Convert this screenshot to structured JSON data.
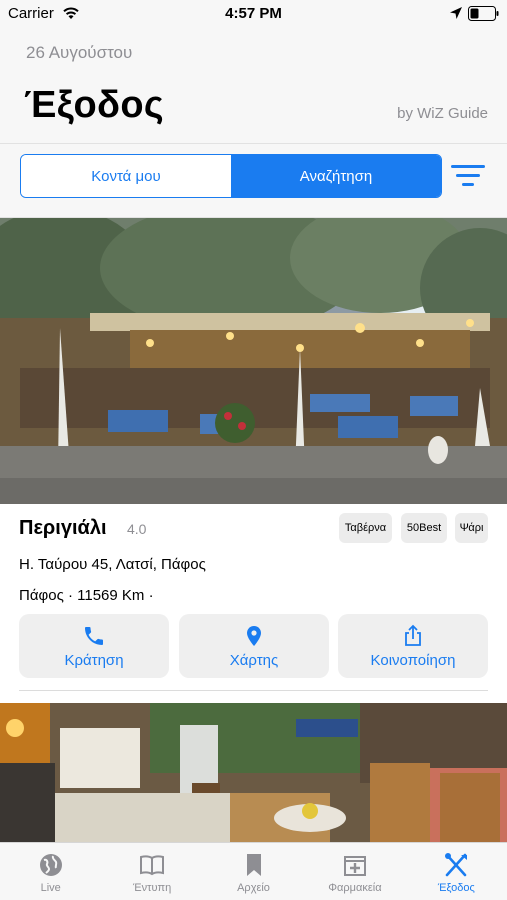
{
  "status_bar": {
    "carrier": "Carrier",
    "time": "4:57 PM",
    "icons": [
      "wifi-icon",
      "location-arrow-icon",
      "battery-icon"
    ]
  },
  "header": {
    "date": "26 Αυγούστου",
    "title": "Έξοδος",
    "byline": "by WiZ Guide"
  },
  "segmented": {
    "options": [
      "Κοντά μου",
      "Αναζήτηση"
    ],
    "selected": "Αναζήτηση"
  },
  "restaurant": {
    "name": "Περιγιάλι",
    "rating": "4.0",
    "tags": [
      "Ταβέρνα",
      "50Best",
      "Ψάρι"
    ],
    "address": "Η. Ταύρου 45, Λατσί, Πάφος",
    "meta": "Πάφος · 11569 Km ·",
    "actions": [
      {
        "label": "Κράτηση",
        "icon": "phone-icon"
      },
      {
        "label": "Χάρτης",
        "icon": "map-pin-icon"
      },
      {
        "label": "Κοινοποίηση",
        "icon": "share-icon"
      }
    ]
  },
  "tab_bar": {
    "items": [
      {
        "label": "Live",
        "icon": "globe-icon"
      },
      {
        "label": "Έντυπη",
        "icon": "book-icon"
      },
      {
        "label": "Αρχείο",
        "icon": "bookmark-icon"
      },
      {
        "label": "Φαρμακεία",
        "icon": "pharmacy-icon"
      },
      {
        "label": "Έξοδος",
        "icon": "fork-knife-icon"
      }
    ],
    "active": "Έξοδος"
  },
  "colors": {
    "accent": "#1a7cf0",
    "secondary_text": "#8e8e93",
    "background": "#f7f7f7"
  }
}
